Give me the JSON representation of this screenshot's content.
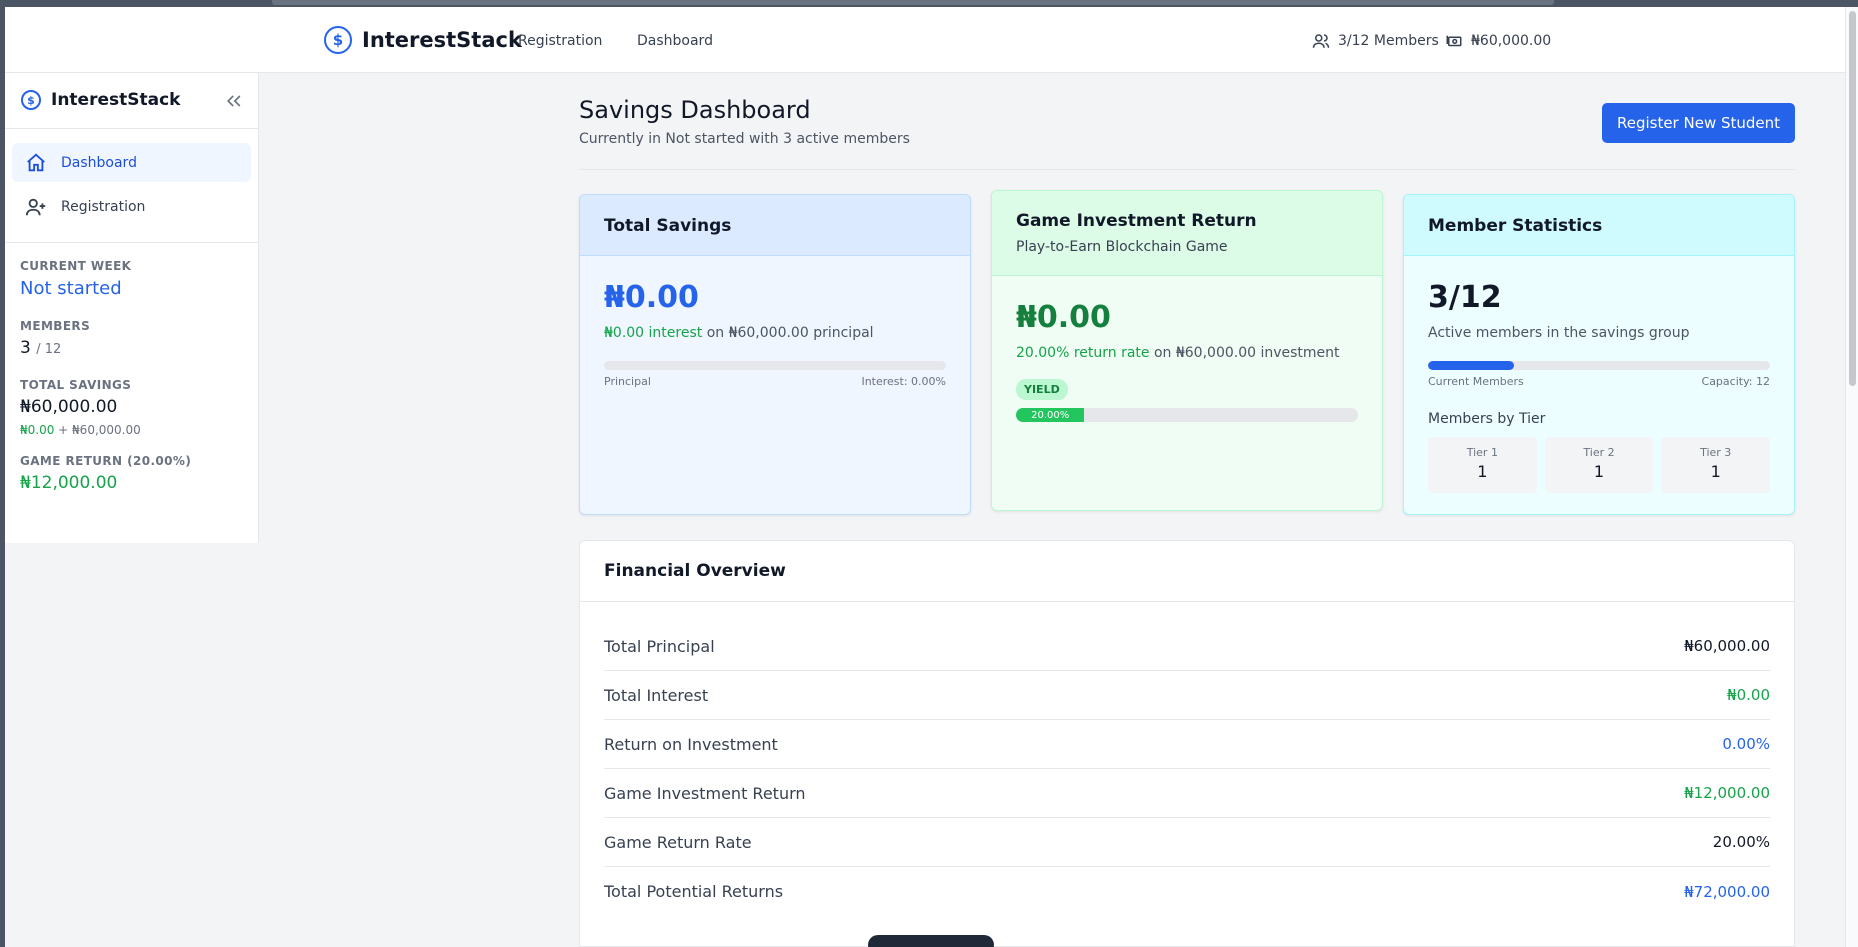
{
  "topnav": {
    "brand": "InterestStack",
    "links": [
      "Registration",
      "Dashboard"
    ],
    "members": "3/12 Members",
    "balance": "₦60,000.00"
  },
  "sidebar": {
    "brand": "InterestStack",
    "items": [
      {
        "label": "Dashboard",
        "icon": "home-icon",
        "active": true
      },
      {
        "label": "Registration",
        "icon": "user-plus-icon",
        "active": false
      }
    ],
    "week_label": "CURRENT WEEK",
    "week_value": "Not started",
    "members_label": "MEMBERS",
    "members_count": "3",
    "members_capacity": "/ 12",
    "savings_label": "TOTAL SAVINGS",
    "savings_value": "₦60,000.00",
    "savings_interest": "₦0.00",
    "savings_plus": " + ",
    "savings_principal": "₦60,000.00",
    "game_label": "GAME RETURN (20.00%)",
    "game_value": "₦12,000.00"
  },
  "main": {
    "title": "Savings Dashboard",
    "subtitle": "Currently in Not started with 3 active members",
    "register_button": "Register New Student"
  },
  "cards": {
    "savings": {
      "title": "Total Savings",
      "amount": "₦0.00",
      "interest_text": "₦0.00 interest",
      "on_text": " on ₦60,000.00 principal",
      "bar_left": "Principal",
      "bar_right": "Interest: 0.00%",
      "progress": 0
    },
    "game": {
      "title": "Game Investment Return",
      "subtitle": "Play-to-Earn Blockchain Game",
      "amount": "₦0.00",
      "rate_text": "20.00% return rate",
      "on_text": " on ₦60,000.00 investment",
      "badge": "YIELD",
      "bar_label": "20.00%",
      "progress": 0.2
    },
    "members": {
      "title": "Member Statistics",
      "count": "3/12",
      "desc": "Active members in the savings group",
      "bar_left": "Current Members",
      "bar_right": "Capacity: 12",
      "progress": 0.25,
      "tiers_title": "Members by Tier",
      "tiers": [
        {
          "label": "Tier 1",
          "value": "1"
        },
        {
          "label": "Tier 2",
          "value": "1"
        },
        {
          "label": "Tier 3",
          "value": "1"
        }
      ]
    }
  },
  "overview": {
    "title": "Financial Overview",
    "rows": [
      {
        "label": "Total Principal",
        "value": "₦60,000.00",
        "color": "#111827"
      },
      {
        "label": "Total Interest",
        "value": "₦0.00",
        "color": "#16a34a"
      },
      {
        "label": "Return on Investment",
        "value": "0.00%",
        "color": "#2563eb"
      },
      {
        "label": "Game Investment Return",
        "value": "₦12,000.00",
        "color": "#16a34a"
      },
      {
        "label": "Game Return Rate",
        "value": "20.00%",
        "color": "#111827"
      },
      {
        "label": "Total Potential Returns",
        "value": "₦72,000.00",
        "color": "#2563eb"
      }
    ]
  },
  "colors": {
    "accent": "#2563eb",
    "green": "#16a34a"
  }
}
